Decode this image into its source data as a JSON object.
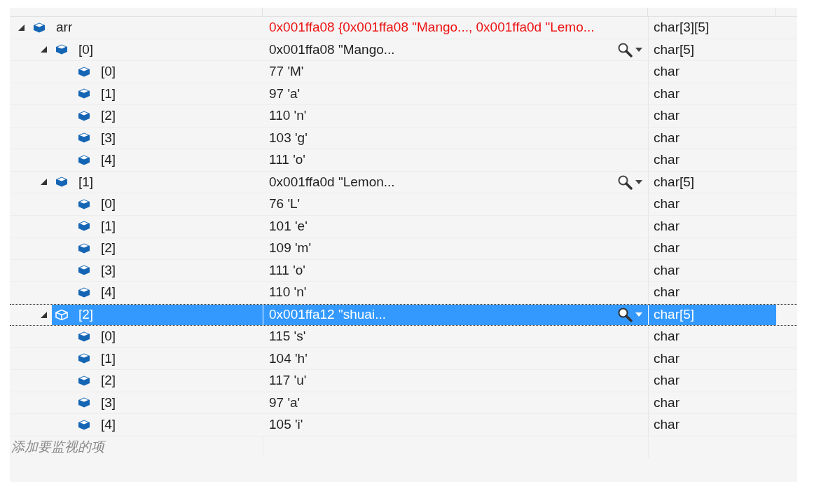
{
  "watch_tree": [
    {
      "name": "arr",
      "value": "0x001ffa08 {0x001ffa08 \"Mango..., 0x001ffa0d \"Lemo...",
      "type": "char[3][5]",
      "expanded": true,
      "changed": true,
      "selected": false,
      "visualizer": false,
      "children": [
        {
          "name": "[0]",
          "value": "0x001ffa08 \"Mango...",
          "type": "char[5]",
          "expanded": true,
          "changed": false,
          "selected": false,
          "visualizer": true,
          "children": [
            {
              "name": "[0]",
              "value": "77 'M'",
              "type": "char",
              "changed": false,
              "selected": false,
              "visualizer": false
            },
            {
              "name": "[1]",
              "value": "97 'a'",
              "type": "char",
              "changed": false,
              "selected": false,
              "visualizer": false
            },
            {
              "name": "[2]",
              "value": "110 'n'",
              "type": "char",
              "changed": false,
              "selected": false,
              "visualizer": false
            },
            {
              "name": "[3]",
              "value": "103 'g'",
              "type": "char",
              "changed": false,
              "selected": false,
              "visualizer": false
            },
            {
              "name": "[4]",
              "value": "111 'o'",
              "type": "char",
              "changed": false,
              "selected": false,
              "visualizer": false
            }
          ]
        },
        {
          "name": "[1]",
          "value": "0x001ffa0d \"Lemon...",
          "type": "char[5]",
          "expanded": true,
          "changed": false,
          "selected": false,
          "visualizer": true,
          "children": [
            {
              "name": "[0]",
              "value": "76 'L'",
              "type": "char",
              "changed": false,
              "selected": false,
              "visualizer": false
            },
            {
              "name": "[1]",
              "value": "101 'e'",
              "type": "char",
              "changed": false,
              "selected": false,
              "visualizer": false
            },
            {
              "name": "[2]",
              "value": "109 'm'",
              "type": "char",
              "changed": false,
              "selected": false,
              "visualizer": false
            },
            {
              "name": "[3]",
              "value": "111 'o'",
              "type": "char",
              "changed": false,
              "selected": false,
              "visualizer": false
            },
            {
              "name": "[4]",
              "value": "110 'n'",
              "type": "char",
              "changed": false,
              "selected": false,
              "visualizer": false
            }
          ]
        },
        {
          "name": "[2]",
          "value": "0x001ffa12 \"shuai...",
          "type": "char[5]",
          "expanded": true,
          "changed": false,
          "selected": true,
          "visualizer": true,
          "children": [
            {
              "name": "[0]",
              "value": "115 's'",
              "type": "char",
              "changed": false,
              "selected": false,
              "visualizer": false
            },
            {
              "name": "[1]",
              "value": "104 'h'",
              "type": "char",
              "changed": false,
              "selected": false,
              "visualizer": false
            },
            {
              "name": "[2]",
              "value": "117 'u'",
              "type": "char",
              "changed": false,
              "selected": false,
              "visualizer": false
            },
            {
              "name": "[3]",
              "value": "97 'a'",
              "type": "char",
              "changed": false,
              "selected": false,
              "visualizer": false
            },
            {
              "name": "[4]",
              "value": "105 'i'",
              "type": "char",
              "changed": false,
              "selected": false,
              "visualizer": false
            }
          ]
        }
      ]
    }
  ],
  "add_watch": {
    "placeholder": "添加要监视的项"
  }
}
